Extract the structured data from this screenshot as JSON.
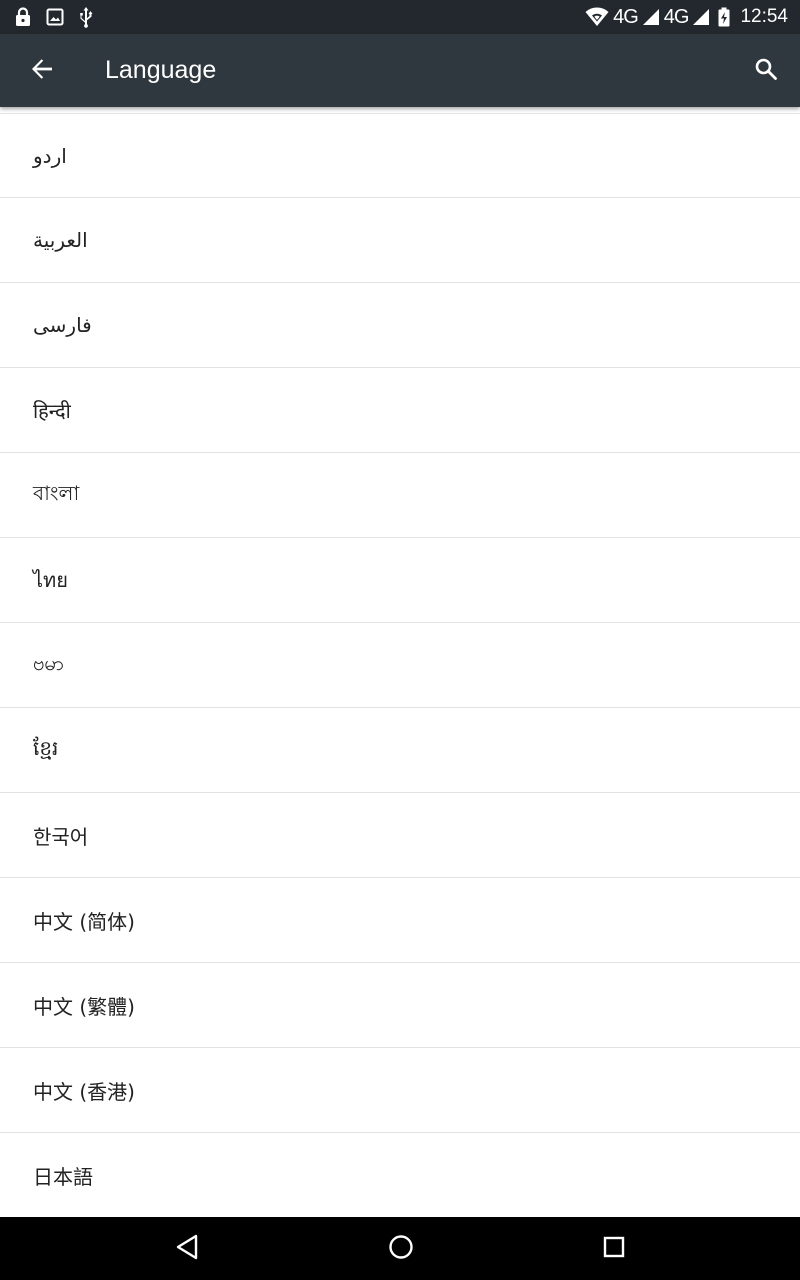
{
  "status_bar": {
    "left_icons": [
      "lock-icon",
      "image-icon",
      "usb-icon"
    ],
    "network_1": "4G",
    "network_2": "4G",
    "time": "12:54"
  },
  "app_bar": {
    "back_icon": "arrow-back-icon",
    "title": "Language",
    "search_icon": "search-icon"
  },
  "languages": [
    "اردو",
    "العربية",
    "فارسی",
    "हिन्दी",
    "বাংলা",
    "ไทย",
    "ဗမာ",
    "ខ្មែរ",
    "한국어",
    "中文 (简体)",
    "中文 (繁體)",
    "中文 (香港)",
    "日本語"
  ],
  "nav_bar": {
    "icons": [
      "nav-back-icon",
      "nav-home-icon",
      "nav-recents-icon"
    ]
  },
  "colors": {
    "status_bar": "#22282d",
    "app_bar": "#2f383e",
    "list_text": "#222222",
    "divider": "#e2e2e2",
    "nav_bar": "#000000"
  }
}
